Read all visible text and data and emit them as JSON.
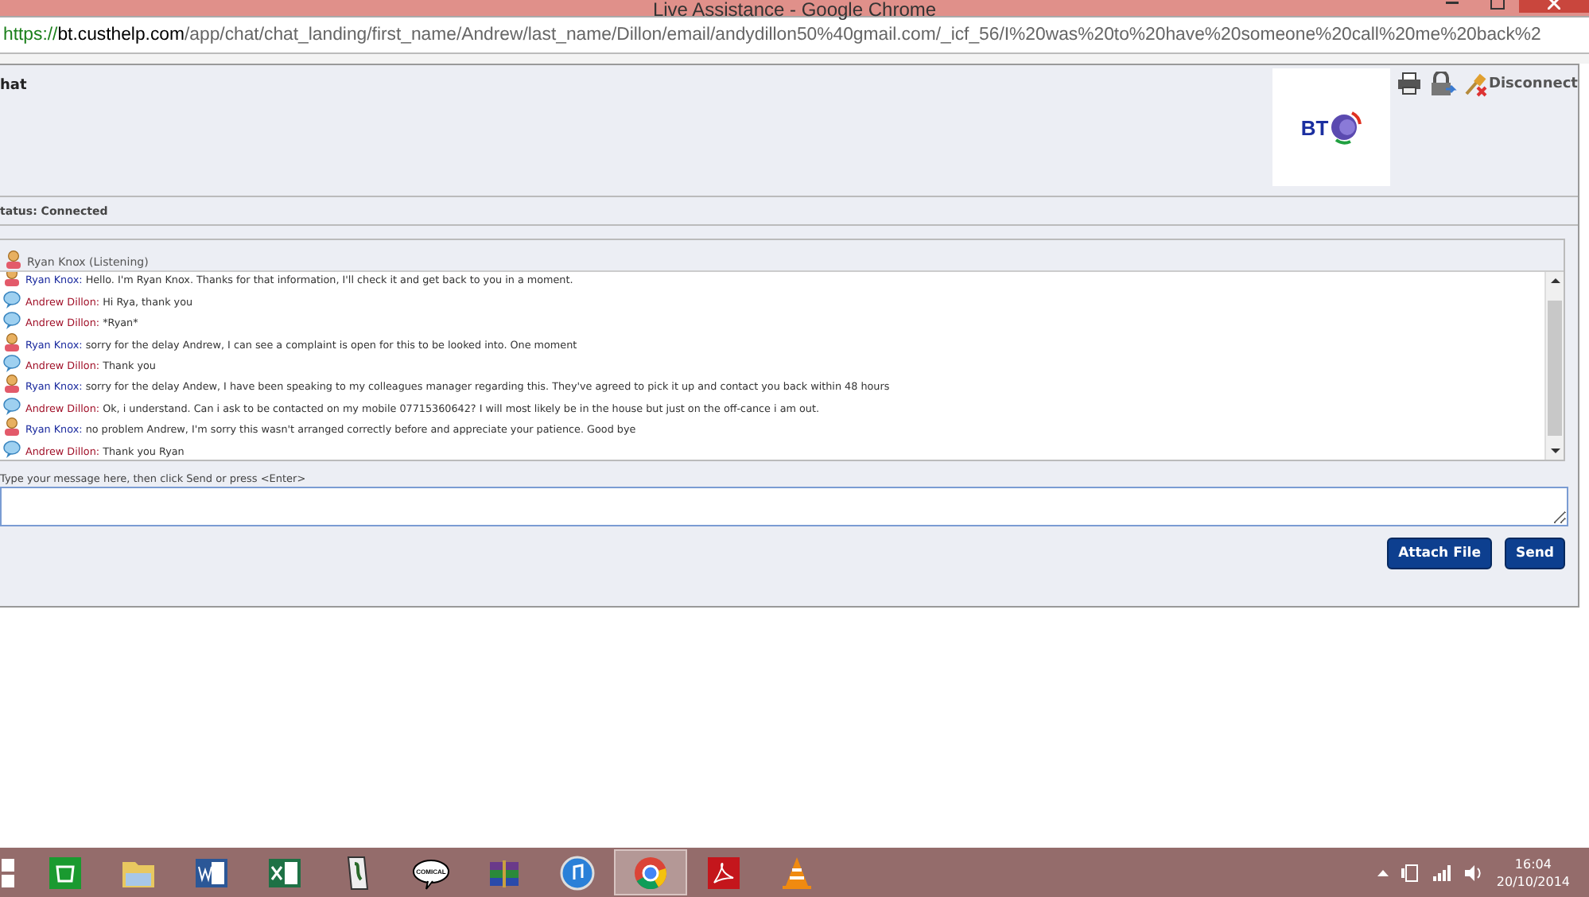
{
  "window": {
    "title": "Live Assistance - Google Chrome"
  },
  "address_bar": {
    "secure_part": "https://",
    "host": "bt.custhelp.com",
    "path": "/app/chat/chat_landing/first_name/Andrew/last_name/Dillon/email/andydillon50%40gmail.com/_icf_56/I%20was%20to%20have%20someone%20call%20me%20back%2"
  },
  "header": {
    "title": "hat",
    "logo_text": "BT",
    "toolbar": [
      {
        "kind": "print"
      },
      {
        "kind": "lock"
      },
      {
        "kind": "disconnect",
        "label": "Disconnect"
      }
    ]
  },
  "status": "tatus: Connected",
  "chat": {
    "participant": "Ryan Knox (Listening)",
    "messages": [
      {
        "kind": "agent",
        "sender": "Ryan Knox:",
        "text": "Hello. I'm Ryan Knox. Thanks for that information, I'll check it and get back to you in a moment."
      },
      {
        "kind": "customer",
        "sender": "Andrew Dillon:",
        "text": "Hi Rya, thank you"
      },
      {
        "kind": "customer",
        "sender": "Andrew Dillon:",
        "text": "*Ryan*"
      },
      {
        "kind": "agent",
        "sender": "Ryan Knox:",
        "text": "sorry for the delay Andrew, I can see a complaint is open for this to be looked into. One moment"
      },
      {
        "kind": "customer",
        "sender": "Andrew Dillon:",
        "text": "Thank you"
      },
      {
        "kind": "agent",
        "sender": "Ryan Knox:",
        "text": "sorry for the delay Andew, I have been speaking to my colleagues manager regarding this. They've agreed to pick it up and contact you back within 48 hours"
      },
      {
        "kind": "customer",
        "sender": "Andrew Dillon:",
        "text": "Ok, i understand. Can i ask to be contacted on my mobile 07715360642? I will most likely be in the house but just on the off-cance i am out."
      },
      {
        "kind": "agent",
        "sender": "Ryan Knox:",
        "text": "no problem Andrew, I'm sorry this wasn't arranged correctly before and appreciate your patience. Good bye"
      },
      {
        "kind": "customer",
        "sender": "Andrew Dillon:",
        "text": "Thank you Ryan"
      }
    ]
  },
  "compose": {
    "prompt": "Type your message here, then click Send or press <Enter>"
  },
  "buttons": [
    "Attach File",
    "Send"
  ],
  "taskbar": {
    "apps": [
      {
        "kind": "start",
        "selected": false
      },
      {
        "kind": "store",
        "selected": false
      },
      {
        "kind": "folder",
        "selected": false
      },
      {
        "kind": "word",
        "selected": false
      },
      {
        "kind": "excel",
        "selected": false
      },
      {
        "kind": "scroll",
        "selected": false
      },
      {
        "kind": "comic",
        "label": "COMICAL",
        "selected": false
      },
      {
        "kind": "archive",
        "selected": false
      },
      {
        "kind": "music",
        "selected": false
      },
      {
        "kind": "browser",
        "selected": true
      },
      {
        "kind": "pdf",
        "selected": false
      },
      {
        "kind": "cone",
        "selected": false
      }
    ],
    "time": "16:04",
    "date": "20/10/2014"
  }
}
